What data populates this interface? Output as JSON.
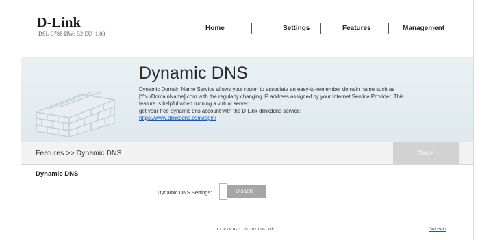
{
  "header": {
    "logo": "D-Link",
    "model_info": "DSL-3788 HW: B2 EU_1.00",
    "nav": [
      {
        "label": "Home"
      },
      {
        "label": "Settings"
      },
      {
        "label": "Features"
      },
      {
        "label": "Management"
      }
    ]
  },
  "banner": {
    "title": "Dynamic DNS",
    "description_lines": [
      "Dynamic Domain Name Service allows your router to associate an easy-to-remember domain name such as",
      "[YourDomainName].com with the regularly changing IP address assigned by your Internet Service Provider. This",
      "feature is helpful when running a virtual server.",
      "get your free dynamic dns account with the D-Link dlinkddns service:"
    ],
    "link": "https://www.dlinkddns.com/login/"
  },
  "breadcrumb": "Features >> Dynamic DNS",
  "toolbar": {
    "save_label": "Save"
  },
  "section": {
    "title": "Dynamic DNS",
    "setting_label": "Dynamic DNS Settings:",
    "toggle_state": "Disable"
  },
  "footer": {
    "copyright": "COPYRIGHT © 2020 D-Link",
    "help_link": "Get Help"
  },
  "colors": {
    "banner_bg": "#e3ecf0",
    "link": "#1a55b8",
    "save_disabled": "#d2d2d2",
    "toggle_bg": "#a6a6a6"
  }
}
